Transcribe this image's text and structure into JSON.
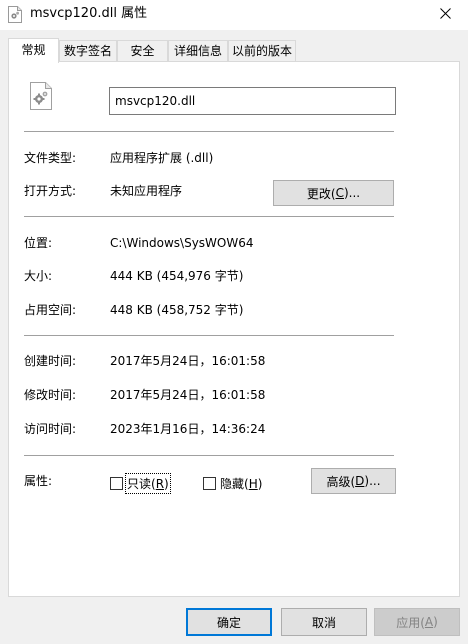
{
  "window": {
    "title": "msvcp120.dll 属性"
  },
  "tabs": [
    {
      "label": "常规",
      "active": true
    },
    {
      "label": "数字签名",
      "active": false
    },
    {
      "label": "安全",
      "active": false
    },
    {
      "label": "详细信息",
      "active": false
    },
    {
      "label": "以前的版本",
      "active": false
    }
  ],
  "general": {
    "file_name": "msvcp120.dll",
    "file_type_label": "文件类型:",
    "file_type_value": "应用程序扩展 (.dll)",
    "opens_with_label": "打开方式:",
    "opens_with_value": "未知应用程序",
    "change_button": {
      "text": "更改(",
      "accel": "C",
      "suffix": ")..."
    },
    "location_label": "位置:",
    "location_value": "C:\\Windows\\SysWOW64",
    "size_label": "大小:",
    "size_value": "444 KB (454,976 字节)",
    "size_on_disk_label": "占用空间:",
    "size_on_disk_value": "448 KB (458,752 字节)",
    "created_label": "创建时间:",
    "created_value": "2017年5月24日，16:01:58",
    "modified_label": "修改时间:",
    "modified_value": "2017年5月24日，16:01:58",
    "accessed_label": "访问时间:",
    "accessed_value": "2023年1月16日，14:36:24",
    "attributes_label": "属性:",
    "readonly": {
      "text": "只读(",
      "accel": "R",
      "suffix": ")",
      "checked": false
    },
    "hidden": {
      "text": "隐藏(",
      "accel": "H",
      "suffix": ")",
      "checked": false
    },
    "advanced_button": {
      "text": "高级(",
      "accel": "D",
      "suffix": ")..."
    }
  },
  "footer": {
    "ok": "确定",
    "cancel": "取消",
    "apply": {
      "text": "应用(",
      "accel": "A",
      "suffix": ")"
    }
  },
  "colors": {
    "window_bg": "#f0f0f0",
    "panel_bg": "#ffffff",
    "button_bg": "#e1e1e1",
    "default_border": "#0078d7",
    "disabled_text": "#838383"
  },
  "icons": {
    "title": "dll-settings-file-icon",
    "file": "dll-settings-file-icon",
    "close": "close-icon"
  }
}
